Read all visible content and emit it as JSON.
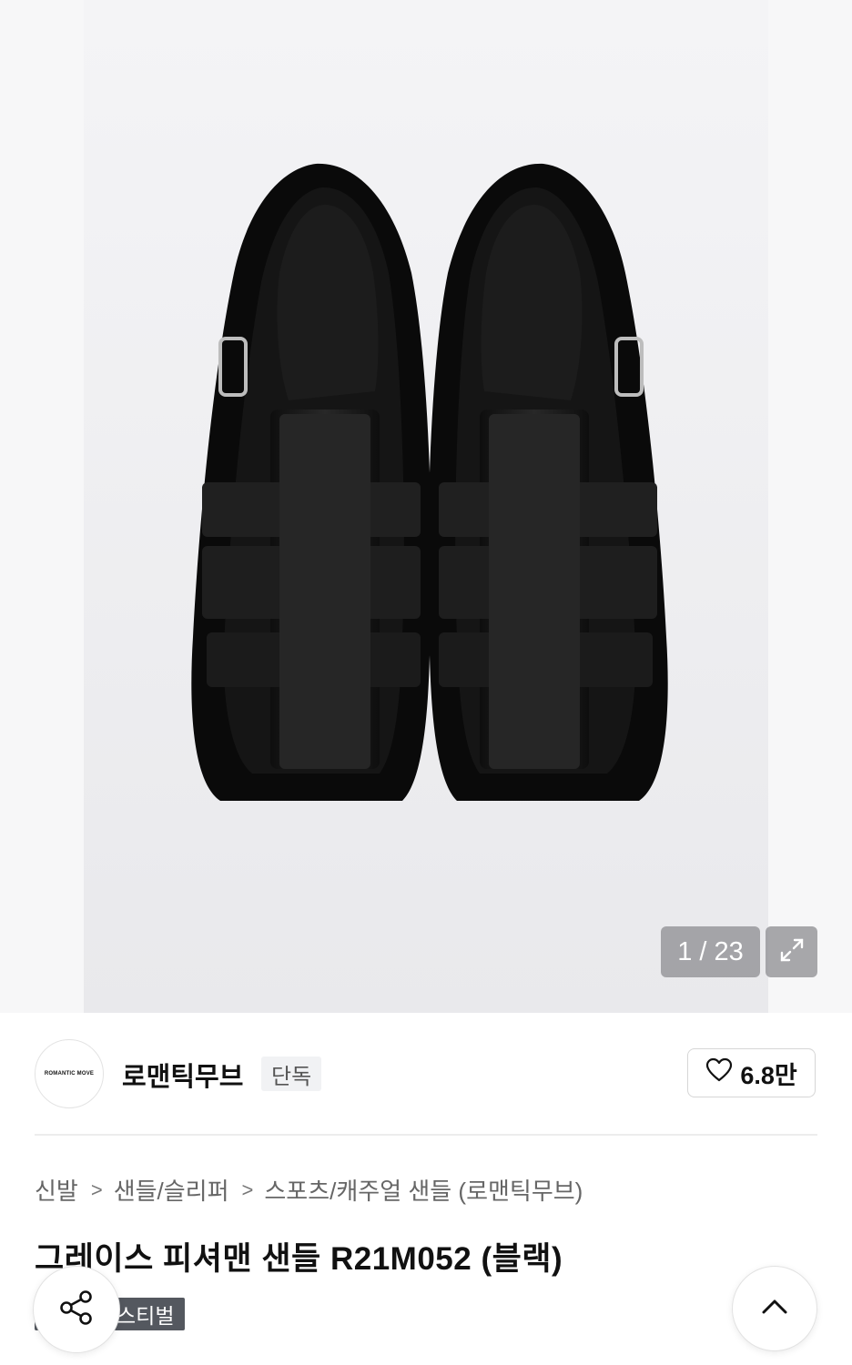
{
  "gallery": {
    "counter": "1 / 23",
    "expand_icon": "expand-icon"
  },
  "brand": {
    "logo_text": "ROMANTIC MOVE",
    "name": "로맨틱무브",
    "badge": "단독",
    "like_count": "6.8만",
    "like_icon": "heart-icon"
  },
  "breadcrumb": {
    "items": [
      "신발",
      "샌들/슬리퍼",
      "스포츠/캐주얼 샌들 (로맨틱무브)"
    ],
    "separator": ">"
  },
  "product": {
    "title": "그레이스 피셔맨 샌들 R21M052 (블랙)",
    "tag": "스티벌"
  },
  "floating": {
    "share_icon": "share-icon",
    "top_icon": "chevron-up-icon"
  }
}
